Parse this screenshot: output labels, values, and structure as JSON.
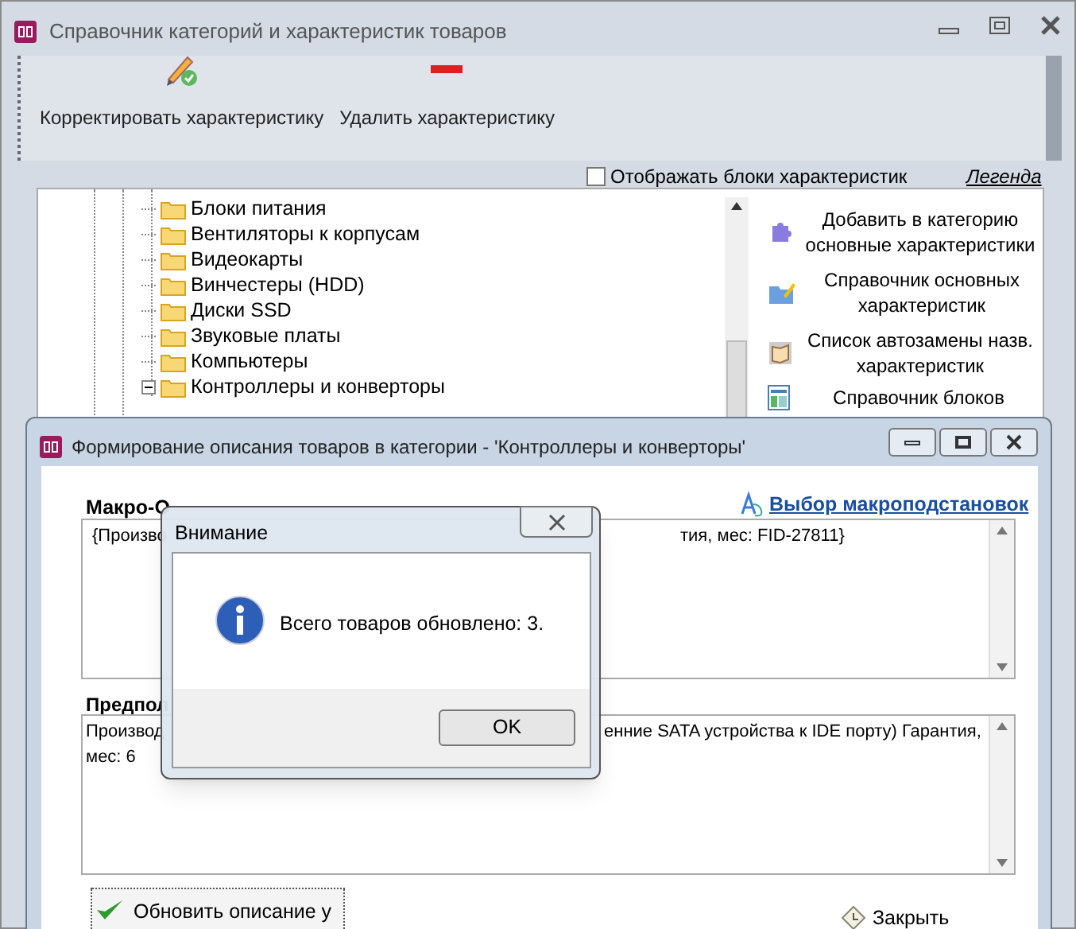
{
  "main_window": {
    "title": "Справочник категорий и характеристик товаров",
    "toolbar": [
      {
        "label": "Корректировать характеристику",
        "kind": "edit"
      },
      {
        "label": "Удалить характеристику",
        "kind": "delete"
      }
    ],
    "show_blocks": {
      "label": "Отображать блоки характеристик",
      "checked": false
    },
    "legend_link": "Легенда",
    "tree": [
      {
        "label": "Блоки питания",
        "expanded": false
      },
      {
        "label": "Вентиляторы к корпусам",
        "expanded": false
      },
      {
        "label": "Видеокарты",
        "expanded": false
      },
      {
        "label": "Винчестеры (HDD)",
        "expanded": false
      },
      {
        "label": "Диски SSD",
        "expanded": false
      },
      {
        "label": "Звуковые платы",
        "expanded": false
      },
      {
        "label": "Компьютеры",
        "expanded": false
      },
      {
        "label": "Контроллеры и конверторы",
        "expanded": true
      }
    ],
    "actions": [
      {
        "label": "Добавить в категорию основные характеристики",
        "kind": "puzzle"
      },
      {
        "label": "Справочник основных характеристик",
        "kind": "folder"
      },
      {
        "label": "Список автозамены назв. характеристик",
        "kind": "book"
      },
      {
        "label": "Справочник блоков",
        "kind": "table"
      }
    ]
  },
  "description_window": {
    "title": "Формирование описания товаров в категории - 'Контроллеры и конверторы'",
    "macro_label": "Макро-О",
    "macro_link": "Выбор макроподстановок",
    "macro_text": [
      "{Произво",
      "тия, мес: FID-27811}"
    ],
    "preview_label": "Предпол",
    "preview_text": [
      "Производ",
      "енние SATA устройства к IDE порту) Гарантия,",
      "мес: 6"
    ],
    "update_button": "Обновить описание у",
    "close_button": "Закрыть"
  },
  "dialog": {
    "title": "Внимание",
    "message": "Всего товаров обновлено: 3.",
    "ok_button": "OK"
  }
}
